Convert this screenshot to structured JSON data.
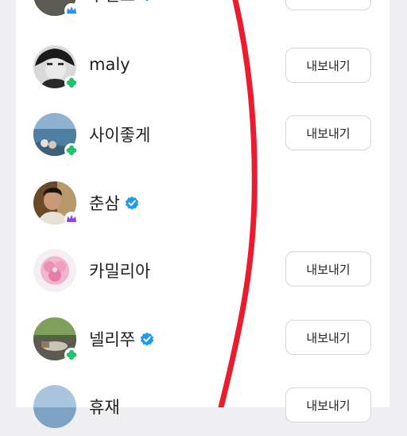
{
  "export_label": "내보내기",
  "colors": {
    "verified": "#1d9bf0",
    "badge_green": "#22c36a",
    "badge_blue": "#2f8fe8",
    "badge_purple": "#8a44d8",
    "annotation_red": "#ea1c2d"
  },
  "users": [
    {
      "name": "루틴즈",
      "verified": true,
      "badge": "crown-icon",
      "badge_color": "blue",
      "has_export": true
    },
    {
      "name": "maly",
      "verified": false,
      "badge": "clover-icon",
      "badge_color": "green",
      "has_export": true
    },
    {
      "name": "사이좋게",
      "verified": false,
      "badge": "clover-icon",
      "badge_color": "green",
      "has_export": true
    },
    {
      "name": "춘삼",
      "verified": true,
      "badge": "crown-icon",
      "badge_color": "purple",
      "has_export": false
    },
    {
      "name": "카밀리아",
      "verified": false,
      "badge": "",
      "has_export": true
    },
    {
      "name": "넬리쭈",
      "verified": true,
      "badge": "clover-icon",
      "badge_color": "green",
      "has_export": true
    },
    {
      "name": "휴재",
      "verified": false,
      "badge": "",
      "has_export": true
    }
  ]
}
